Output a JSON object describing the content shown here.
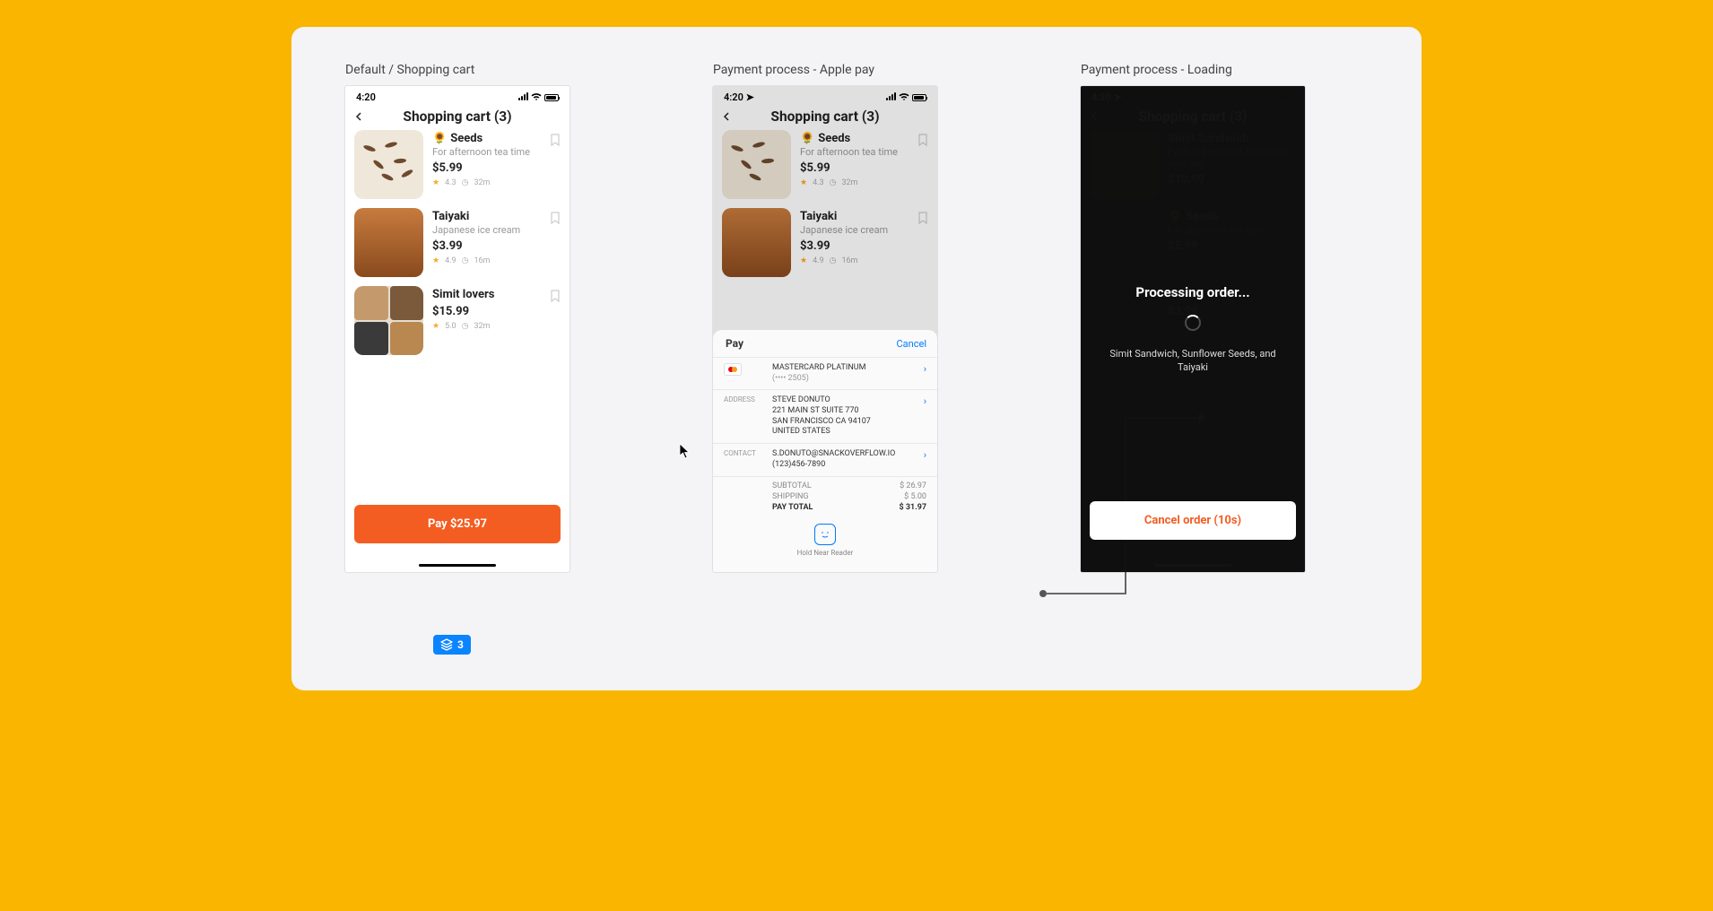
{
  "frames": {
    "cart": {
      "label": "Default / Shopping cart"
    },
    "applepay": {
      "label": "Payment process - Apple pay"
    },
    "loading": {
      "label": "Payment process - Loading"
    }
  },
  "status_time": "4:20",
  "cart": {
    "title": "Shopping cart (3)",
    "items": [
      {
        "emoji": "🌻",
        "name": "Seeds",
        "desc": "For afternoon tea time",
        "price": "$5.99",
        "rating": "4.3",
        "duration": "32m"
      },
      {
        "emoji": "",
        "name": "Taiyaki",
        "desc": "Japanese ice cream",
        "price": "$3.99",
        "rating": "4.9",
        "duration": "16m"
      },
      {
        "emoji": "",
        "name": "Simit lovers",
        "desc": "",
        "price": "$15.99",
        "rating": "5.0",
        "duration": "32m"
      }
    ],
    "pay_label": "Pay $25.97"
  },
  "applepay": {
    "cancel_label": "Cancel",
    "card_name": "MASTERCARD PLATINUM",
    "card_mask": "(•••• 2505)",
    "address_label": "ADDRESS",
    "address_name": "STEVE DONUTO",
    "address_line1": "221 MAIN ST SUITE 770",
    "address_line2": "SAN FRANCISCO CA 94107",
    "address_line3": "UNITED STATES",
    "contact_label": "CONTACT",
    "contact_email": "S.DONUTO@SNACKOVERFLOW.IO",
    "contact_phone": "(123)456-7890",
    "subtotal_label": "SUBTOTAL",
    "subtotal_value": "$ 26.97",
    "shipping_label": "SHIPPING",
    "shipping_value": "$ 5.00",
    "total_label": "PAY TOTAL",
    "total_value": "$ 31.97",
    "hint": "Hold Near Reader"
  },
  "loading": {
    "title_dimmed": "Shopping cart (3)",
    "processing": "Processing order...",
    "items_summary": "Simit Sandwich, Sunflower Seeds, and Taiyaki",
    "cancel_label": "Cancel order (10s)",
    "item0": {
      "name": "Simit Sandwich",
      "desc": "Perfect breakfast to kick off your day",
      "price": "$10.99"
    },
    "item1": {
      "name": "Seeds",
      "desc": "For afternoon tea time",
      "price": "$5.99"
    },
    "item2": {
      "name": "Taiyaki",
      "desc": "",
      "price": "$3.99"
    }
  },
  "layers_badge": "3"
}
